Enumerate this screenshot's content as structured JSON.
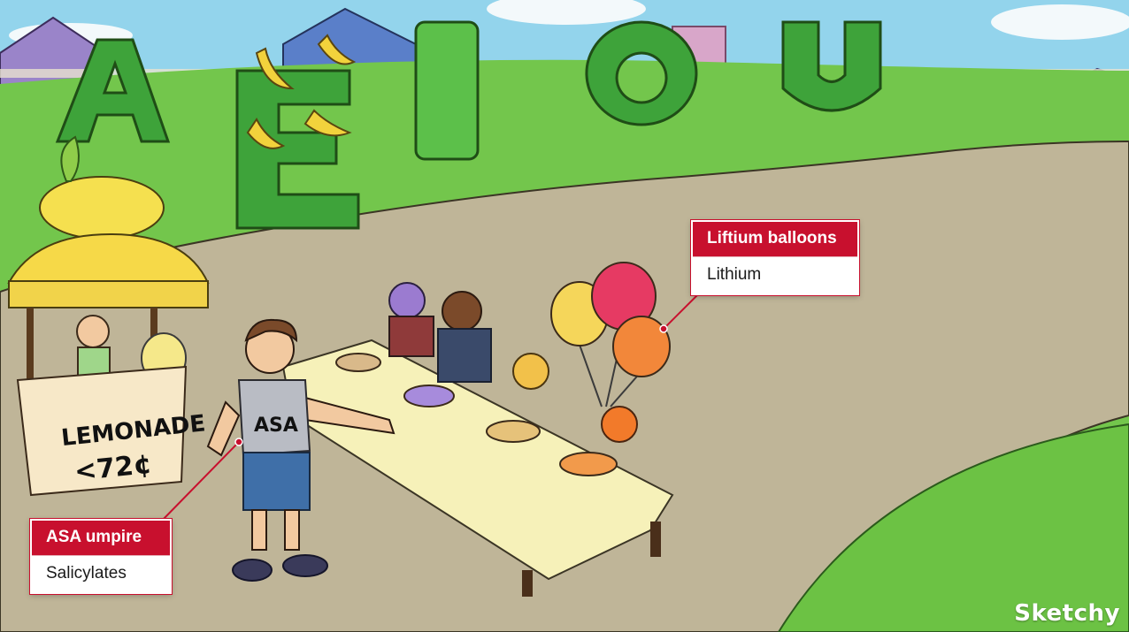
{
  "callouts": [
    {
      "header": "ASA umpire",
      "body": "Salicylates"
    },
    {
      "header": "Liftium balloons",
      "body": "Lithium"
    }
  ],
  "sign": {
    "line1": "LEMONADE",
    "line2": "<72¢"
  },
  "vest_label": "ASA",
  "topiary_letters": [
    "A",
    "E",
    "I",
    "O",
    "U"
  ],
  "brand": "Sketchy",
  "colors": {
    "callout_header": "#c8102e",
    "grass": "#6fc24a",
    "path": "#bdb295",
    "tablecloth": "#f6f1b9"
  }
}
